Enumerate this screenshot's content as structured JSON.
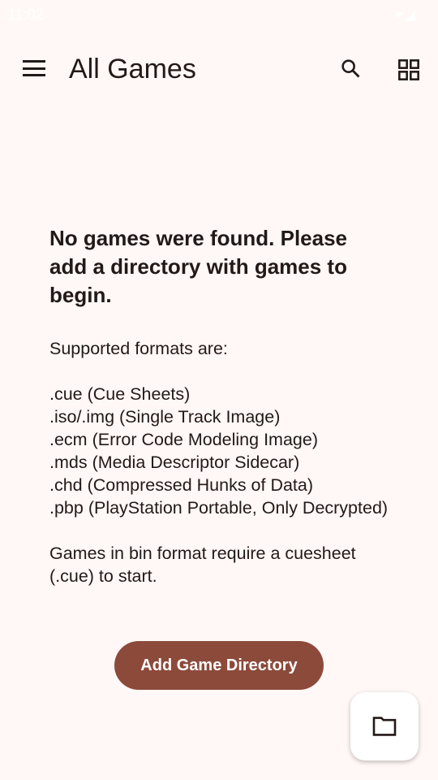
{
  "status": {
    "time": "11:02"
  },
  "appbar": {
    "title": "All Games"
  },
  "empty": {
    "heading": "No games were found. Please add a directory with games to begin.",
    "body": "Supported formats are:\n\n.cue (Cue Sheets)\n.iso/.img (Single Track Image)\n.ecm (Error Code Modeling Image)\n.mds (Media Descriptor Sidecar)\n.chd (Compressed Hunks of Data)\n.pbp (PlayStation Portable, Only Decrypted)\n\nGames in bin format require a cuesheet (.cue) to start.",
    "button": "Add Game Directory"
  },
  "colors": {
    "accent": "#8c4a3b",
    "background": "#fff8f6"
  }
}
